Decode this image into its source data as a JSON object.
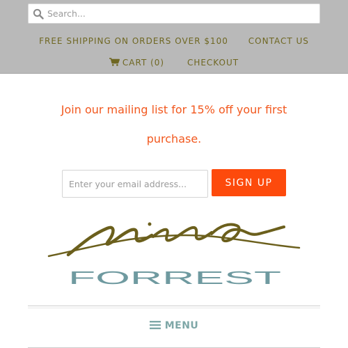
{
  "search": {
    "placeholder": "Search..."
  },
  "top_nav": {
    "free_shipping": "FREE SHIPPING ON ORDERS OVER $100",
    "contact": "CONTACT US",
    "cart": "CART (0)",
    "checkout": "CHECKOUT"
  },
  "newsletter": {
    "line1": "Join our mailing list for 15% off your first",
    "line2": "purchase.",
    "email_placeholder": "Enter your email address...",
    "signup_label": "SIGN UP"
  },
  "logo": {
    "script": "nina",
    "wordmark": "FORREST"
  },
  "menu": {
    "label": "MENU"
  },
  "colors": {
    "nav_text": "#6f6722",
    "promo_text": "#f2581e",
    "signup_bg": "#fd4a0c",
    "logo_script": "#6b5f1c",
    "logo_wordmark": "#6f9aa0",
    "menu_text": "#7ea7a7"
  }
}
